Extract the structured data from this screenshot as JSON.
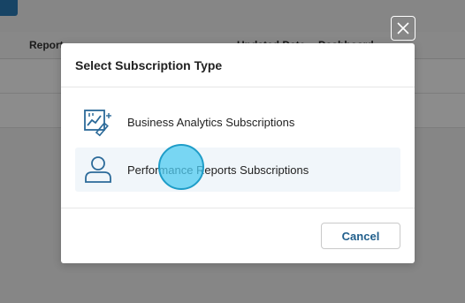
{
  "background": {
    "columns": [
      "Report",
      "Updated Date",
      "Dashboard"
    ]
  },
  "dialog": {
    "title": "Select Subscription Type",
    "options": [
      {
        "label": "Business Analytics Subscriptions",
        "icon": "analytics-chart-icon"
      },
      {
        "label": "Performance Reports Subscriptions",
        "icon": "user-icon"
      }
    ],
    "cancel_label": "Cancel",
    "close_icon": "close-icon"
  },
  "colors": {
    "accent": "#215f8c",
    "icon": "#2b6a99",
    "hover_row": "#f1f6fa",
    "cursor": "#4fcbf0"
  }
}
